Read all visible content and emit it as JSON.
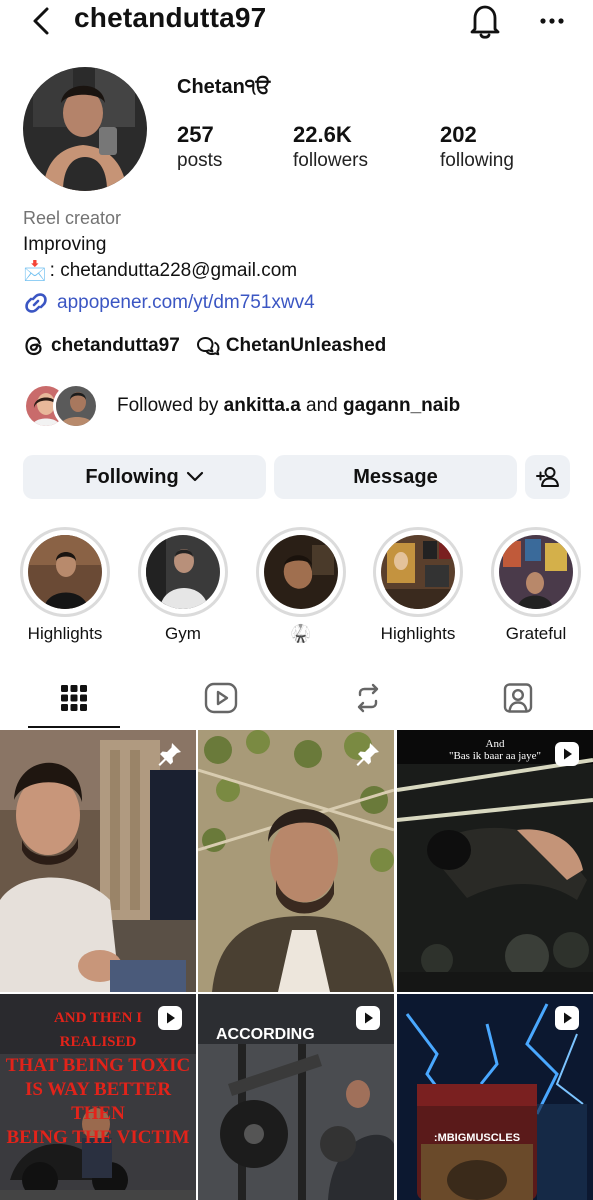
{
  "header": {
    "username": "chetandutta97",
    "back_icon": "chevron-left-icon",
    "bell_icon": "bell-icon",
    "more_icon": "more-horizontal-icon"
  },
  "profile": {
    "display_name": "Chetan੧ੳ",
    "stats": [
      {
        "value": "257",
        "label": "posts"
      },
      {
        "value": "22.6K",
        "label": "followers"
      },
      {
        "value": "202",
        "label": "following"
      }
    ],
    "category": "Reel creator",
    "bio": "Improving",
    "email_prefix": "📩",
    "email_text": ": chetandutta228@gmail.com",
    "link": "appopener.com/yt/dm751xwv4",
    "threads_handle": "chetandutta97",
    "channel_name": "ChetanUnleashed"
  },
  "followed_by": {
    "prefix": "Followed by ",
    "user1": "ankitta.a",
    "joiner": " and ",
    "user2": "gagann_naib"
  },
  "actions": {
    "following_label": "Following",
    "message_label": "Message",
    "add_user_icon": "person-add-icon"
  },
  "highlights": [
    {
      "label": "Highlights"
    },
    {
      "label": "Gym"
    },
    {
      "label": "🥋"
    },
    {
      "label": "Highlights"
    },
    {
      "label": "Grateful"
    }
  ],
  "tabs": [
    {
      "icon": "grid-icon",
      "active": true
    },
    {
      "icon": "reels-icon",
      "active": false
    },
    {
      "icon": "repost-icon",
      "active": false
    },
    {
      "icon": "tagged-icon",
      "active": false
    }
  ],
  "grid_posts": [
    {
      "badge": "pin-icon"
    },
    {
      "badge": "pin-icon"
    },
    {
      "badge": "reel-icon",
      "overlay_line1": "And",
      "overlay_line2": "\"Bas ik baar aa jaye\""
    },
    {
      "badge": "reel-icon",
      "overlay_lines": [
        "AND THEN I",
        "REALISED",
        "THAT BEING TOXIC",
        "IS WAY BETTER",
        "THEN",
        "BEING THE VICTIM"
      ]
    },
    {
      "badge": "reel-icon",
      "overlay_line1": "ACCORDING"
    },
    {
      "badge": "reel-icon",
      "overlay_line1": ":MBIGMUSCLES"
    }
  ],
  "colors": {
    "link": "#3b56c3",
    "button_bg": "#eef1f5",
    "muted": "#737373",
    "ring": "#dbdbdb"
  }
}
